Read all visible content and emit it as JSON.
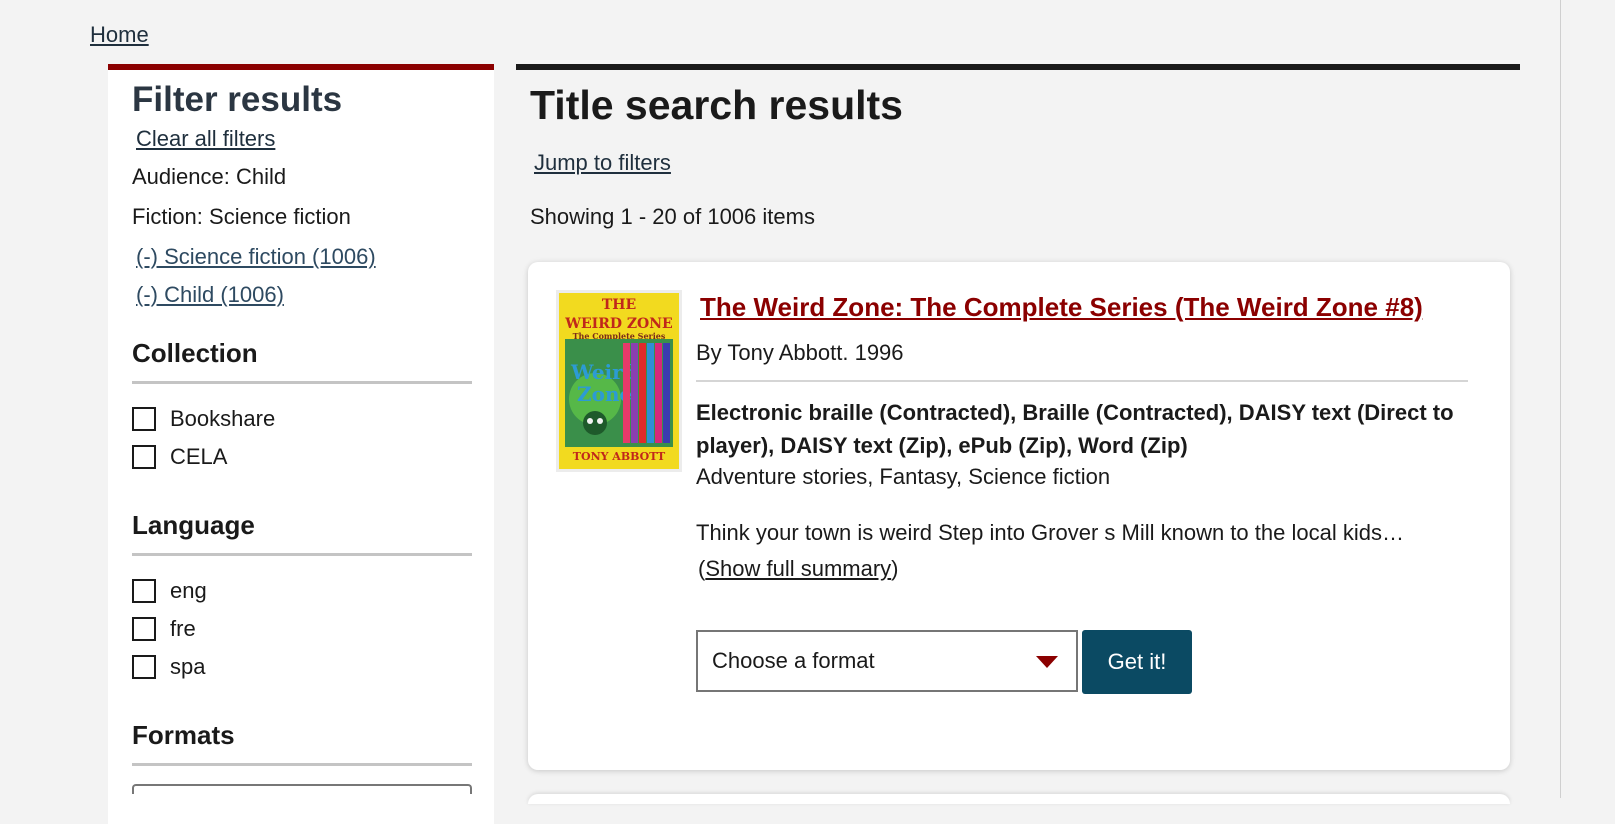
{
  "breadcrumb": {
    "home": "Home"
  },
  "sidebar": {
    "title": "Filter results",
    "clear_all": "Clear all filters",
    "active_filters": [
      {
        "label": "Audience: Child"
      },
      {
        "label": "Fiction: Science fiction"
      }
    ],
    "remove_links": [
      {
        "label": "(-) Science fiction (1006)"
      },
      {
        "label": "(-) Child (1006)"
      }
    ],
    "facets": {
      "collection": {
        "heading": "Collection",
        "options": [
          {
            "label": "Bookshare",
            "checked": false
          },
          {
            "label": "CELA",
            "checked": false
          }
        ]
      },
      "language": {
        "heading": "Language",
        "options": [
          {
            "label": "eng",
            "checked": false
          },
          {
            "label": "fre",
            "checked": false
          },
          {
            "label": "spa",
            "checked": false
          }
        ]
      },
      "formats": {
        "heading": "Formats"
      }
    }
  },
  "main": {
    "title": "Title search results",
    "jump_link": "Jump to filters",
    "showing": "Showing 1 - 20 of 1006 items"
  },
  "results": [
    {
      "title": "The Weird Zone: The Complete Series (The Weird Zone #8)",
      "byline": "By Tony Abbott. 1996",
      "formats": "Electronic braille (Contracted), Braille (Contracted), DAISY text (Direct to player), DAISY text (Zip), ePub (Zip), Word (Zip)",
      "genres": "Adventure stories, Fantasy, Science fiction",
      "summary": "Think your town is weird Step into Grover s Mill known to the local kids…",
      "summary_toggle": "Show full summary",
      "format_select": {
        "placeholder": "Choose a format"
      },
      "get_button": "Get it!",
      "cover": {
        "title_line1": "THE",
        "title_line2": "WEIRD ZONE",
        "subtitle": "The Complete Series",
        "author": "TONY ABBOTT"
      }
    }
  ],
  "colors": {
    "accent_red": "#8b0000",
    "button_teal": "#0b4a63",
    "cover_yellow": "#f2da1f"
  }
}
